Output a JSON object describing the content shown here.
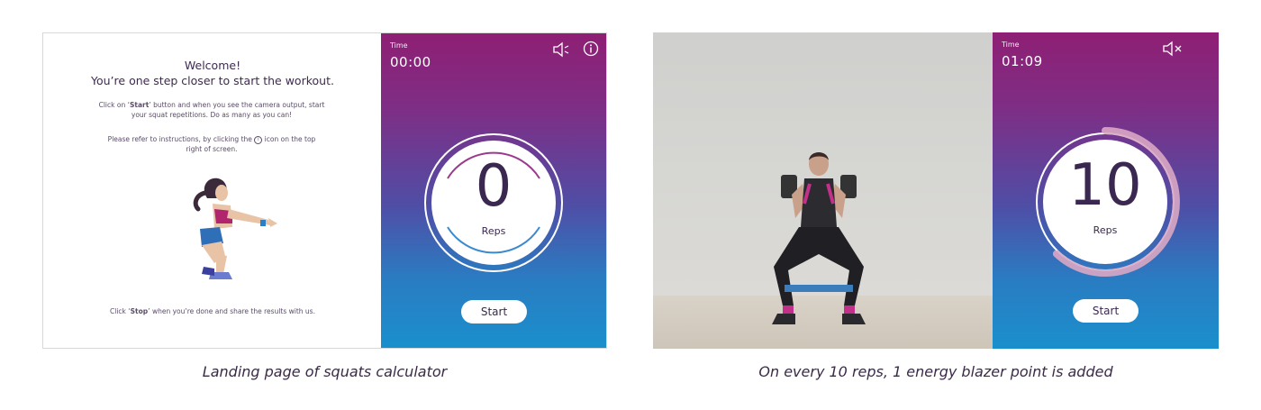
{
  "landing": {
    "welcome_title": "Welcome!",
    "welcome_subtitle": "You’re one step closer to start the workout.",
    "instr_start_pre": "Click on ‘",
    "instr_start_word": "Start",
    "instr_start_post": "’ button and when you see the camera output, start your squat repetitions. Do as many as you can!",
    "instr_info_pre": "Please refer to instructions, by clicking the",
    "instr_info_icon": "i",
    "instr_info_post": "icon on the top right of screen.",
    "footer_pre": "Click ‘",
    "footer_word": "Stop",
    "footer_post": "’ when you’re done and share the results with us.",
    "illustration": "squatting-woman-illustration",
    "counter": {
      "time_label": "Time",
      "time_value": "00:00",
      "count": "0",
      "reps_label": "Reps",
      "start_label": "Start",
      "icons": [
        "speaker-icon",
        "info-icon"
      ]
    }
  },
  "active": {
    "photo": "woman-squatting-with-dumbbells-photo",
    "counter": {
      "time_label": "Time",
      "time_value": "01:09",
      "count": "10",
      "reps_label": "Reps",
      "start_label": "Start",
      "progress_fraction": 0.62,
      "icons": [
        "muted-speaker-icon"
      ]
    }
  },
  "captions": {
    "left": "Landing page of squats calculator",
    "right": "On every 10 reps, 1 energy blazer point is added"
  },
  "colors": {
    "gradient_top": "#8e1f74",
    "gradient_mid": "#4f4ea6",
    "gradient_bottom": "#1a8fcc",
    "text_dark": "#3a2850"
  }
}
